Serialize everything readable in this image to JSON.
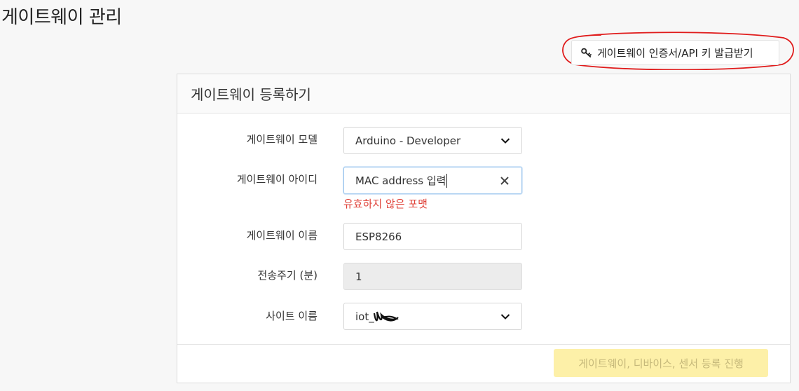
{
  "page": {
    "title": "게이트웨이 관리"
  },
  "toolbar": {
    "cert_button_label": "게이트웨이 인증서/API 키 발급받기",
    "cert_icon": "key-icon"
  },
  "panel": {
    "title": "게이트웨이 등록하기",
    "fields": {
      "model": {
        "label": "게이트웨이 모델",
        "value": "Arduino - Developer"
      },
      "id": {
        "label": "게이트웨이 아이디",
        "value": "MAC address 입력",
        "error": "유효하지 않은 포맷"
      },
      "name": {
        "label": "게이트웨이 이름",
        "value": "ESP8266"
      },
      "period": {
        "label": "전송주기 (분)",
        "value": "1"
      },
      "site": {
        "label": "사이트 이름",
        "value": "iot_"
      }
    },
    "submit_label": "게이트웨이, 디바이스, 센서 등록 진행"
  },
  "colors": {
    "annotation": "#e01b1b",
    "error": "#e0433a",
    "submit_bg": "#fdf0a8"
  }
}
